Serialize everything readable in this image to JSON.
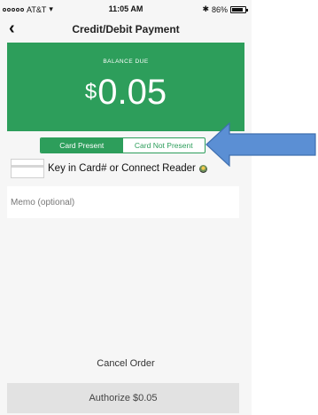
{
  "status_bar": {
    "carrier": "AT&T",
    "time": "11:05 AM",
    "battery": "86%"
  },
  "nav": {
    "title": "Credit/Debit Payment"
  },
  "balance": {
    "label": "BALANCE DUE",
    "currency": "$",
    "amount": "0.05"
  },
  "payment_mode": {
    "options": [
      "Card Present",
      "Card Not Present"
    ],
    "selected": "Card Present"
  },
  "card_entry": {
    "label": "Key in Card# or Connect Reader"
  },
  "memo": {
    "placeholder": "Memo (optional)",
    "value": ""
  },
  "actions": {
    "cancel_label": "Cancel Order",
    "authorize_label": "Authorize $0.05"
  },
  "colors": {
    "accent": "#2d9e5b",
    "annotation_arrow": "#5b8fd4"
  },
  "icons": [
    "signal-icon",
    "wifi-icon",
    "bluetooth-icon",
    "battery-icon",
    "back-icon",
    "card-icon",
    "reader-icon",
    "arrow-icon"
  ]
}
